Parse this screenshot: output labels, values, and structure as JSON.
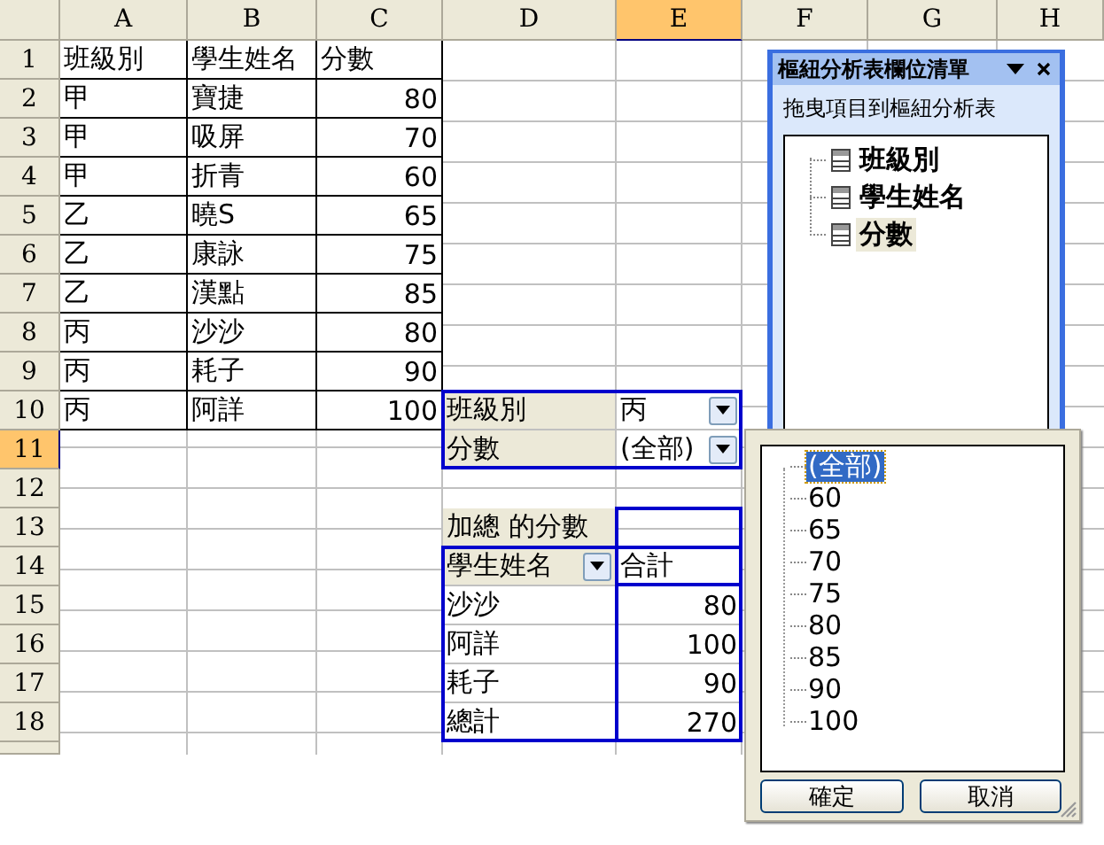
{
  "sheet": {
    "columns": [
      {
        "label": "A",
        "selected": false
      },
      {
        "label": "B",
        "selected": false
      },
      {
        "label": "C",
        "selected": false
      },
      {
        "label": "D",
        "selected": false
      },
      {
        "label": "E",
        "selected": true
      },
      {
        "label": "F",
        "selected": false
      },
      {
        "label": "G",
        "selected": false
      },
      {
        "label": "H",
        "selected": false
      }
    ],
    "rows": [
      {
        "label": "1",
        "selected": false,
        "cells": [
          {
            "kind": "text",
            "text": "班級別"
          },
          {
            "kind": "text",
            "text": "學生姓名"
          },
          {
            "kind": "text",
            "text": "分數"
          }
        ]
      },
      {
        "label": "2",
        "selected": false,
        "cells": [
          {
            "kind": "text",
            "text": "甲"
          },
          {
            "kind": "text",
            "text": "寶捷"
          },
          {
            "kind": "number",
            "text": "80"
          }
        ]
      },
      {
        "label": "3",
        "selected": false,
        "cells": [
          {
            "kind": "text",
            "text": "甲"
          },
          {
            "kind": "text",
            "text": "吸屏"
          },
          {
            "kind": "number",
            "text": "70"
          }
        ]
      },
      {
        "label": "4",
        "selected": false,
        "cells": [
          {
            "kind": "text",
            "text": "甲"
          },
          {
            "kind": "text",
            "text": "折青"
          },
          {
            "kind": "number",
            "text": "60"
          }
        ]
      },
      {
        "label": "5",
        "selected": false,
        "cells": [
          {
            "kind": "text",
            "text": "乙"
          },
          {
            "kind": "text",
            "text": "曉S"
          },
          {
            "kind": "number",
            "text": "65"
          }
        ]
      },
      {
        "label": "6",
        "selected": false,
        "cells": [
          {
            "kind": "text",
            "text": "乙"
          },
          {
            "kind": "text",
            "text": "康詠"
          },
          {
            "kind": "number",
            "text": "75"
          }
        ]
      },
      {
        "label": "7",
        "selected": false,
        "cells": [
          {
            "kind": "text",
            "text": "乙"
          },
          {
            "kind": "text",
            "text": "漢點"
          },
          {
            "kind": "number",
            "text": "85"
          }
        ]
      },
      {
        "label": "8",
        "selected": false,
        "cells": [
          {
            "kind": "text",
            "text": "丙"
          },
          {
            "kind": "text",
            "text": "沙沙"
          },
          {
            "kind": "number",
            "text": "80"
          }
        ]
      },
      {
        "label": "9",
        "selected": false,
        "cells": [
          {
            "kind": "text",
            "text": "丙"
          },
          {
            "kind": "text",
            "text": "耗子"
          },
          {
            "kind": "number",
            "text": "90"
          }
        ]
      },
      {
        "label": "10",
        "selected": false,
        "cells": [
          {
            "kind": "text",
            "text": "丙"
          },
          {
            "kind": "text",
            "text": "阿詳"
          },
          {
            "kind": "number",
            "text": "100"
          },
          {
            "kind": "pivot_field",
            "text": "班級別"
          },
          {
            "kind": "pivot_dropdown",
            "text": "丙"
          }
        ]
      },
      {
        "label": "11",
        "selected": true,
        "cells": [
          {
            "kind": "empty"
          },
          {
            "kind": "empty"
          },
          {
            "kind": "empty"
          },
          {
            "kind": "pivot_field",
            "text": "分數"
          },
          {
            "kind": "pivot_dropdown",
            "text": "(全部)"
          }
        ]
      },
      {
        "label": "12",
        "selected": false,
        "cells": []
      },
      {
        "label": "13",
        "selected": false,
        "cells": [
          {
            "kind": "empty"
          },
          {
            "kind": "empty"
          },
          {
            "kind": "empty"
          },
          {
            "kind": "pivot_field",
            "text": "加總 的分數"
          }
        ]
      },
      {
        "label": "14",
        "selected": false,
        "cells": [
          {
            "kind": "empty"
          },
          {
            "kind": "empty"
          },
          {
            "kind": "empty"
          },
          {
            "kind": "pivot_field_dropdown",
            "text": "學生姓名"
          },
          {
            "kind": "pivot_text",
            "text": "合計"
          }
        ]
      },
      {
        "label": "15",
        "selected": false,
        "cells": [
          {
            "kind": "empty"
          },
          {
            "kind": "empty"
          },
          {
            "kind": "empty"
          },
          {
            "kind": "pivot_text",
            "text": "沙沙"
          },
          {
            "kind": "pivot_number",
            "text": "80"
          }
        ]
      },
      {
        "label": "16",
        "selected": false,
        "cells": [
          {
            "kind": "empty"
          },
          {
            "kind": "empty"
          },
          {
            "kind": "empty"
          },
          {
            "kind": "pivot_text",
            "text": "阿詳"
          },
          {
            "kind": "pivot_number",
            "text": "100"
          }
        ]
      },
      {
        "label": "17",
        "selected": false,
        "cells": [
          {
            "kind": "empty"
          },
          {
            "kind": "empty"
          },
          {
            "kind": "empty"
          },
          {
            "kind": "pivot_text",
            "text": "耗子"
          },
          {
            "kind": "pivot_number",
            "text": "90"
          }
        ]
      },
      {
        "label": "18",
        "selected": false,
        "cells": [
          {
            "kind": "empty"
          },
          {
            "kind": "empty"
          },
          {
            "kind": "empty"
          },
          {
            "kind": "pivot_text",
            "text": "總計"
          },
          {
            "kind": "pivot_number",
            "text": "270"
          }
        ]
      }
    ]
  },
  "field_list": {
    "title": "樞紐分析表欄位清單",
    "hint": "拖曳項目到樞紐分析表",
    "fields": [
      {
        "label": "班級別",
        "selected": false
      },
      {
        "label": "學生姓名",
        "selected": false
      },
      {
        "label": "分數",
        "selected": true
      }
    ]
  },
  "filter_dropdown": {
    "items": [
      {
        "label": "(全部)",
        "selected": true
      },
      {
        "label": "60",
        "selected": false
      },
      {
        "label": "65",
        "selected": false
      },
      {
        "label": "70",
        "selected": false
      },
      {
        "label": "75",
        "selected": false
      },
      {
        "label": "80",
        "selected": false
      },
      {
        "label": "85",
        "selected": false
      },
      {
        "label": "90",
        "selected": false
      },
      {
        "label": "100",
        "selected": false
      }
    ],
    "buttons": [
      "確定",
      "取消"
    ]
  }
}
